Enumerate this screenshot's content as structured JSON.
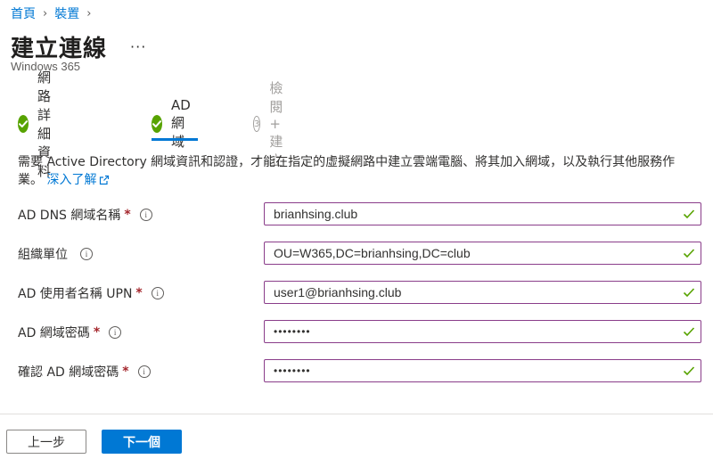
{
  "breadcrumb": {
    "home": "首頁",
    "devices": "裝置"
  },
  "header": {
    "title": "建立連線",
    "more": "···",
    "subtitle": "Windows 365"
  },
  "steps": [
    {
      "label": "網路詳細資料",
      "state": "done"
    },
    {
      "label": "AD 網域",
      "state": "current"
    },
    {
      "label": "檢閱 + 建立",
      "number": "3",
      "state": "disabled"
    }
  ],
  "description": {
    "text": "需要 Active Directory 網域資訊和認證，才能在指定的虛擬網路中建立雲端電腦、將其加入網域，以及執行其他服務作業。",
    "link": "深入了解"
  },
  "fields": [
    {
      "label": "AD DNS 網域名稱",
      "required": "*",
      "value": "brianhsing.club"
    },
    {
      "label": "組織單位",
      "required": "",
      "value": "OU=W365,DC=brianhsing,DC=club"
    },
    {
      "label": "AD 使用者名稱 UPN",
      "required": "*",
      "value": "user1@brianhsing.club"
    },
    {
      "label": "AD 網域密碼",
      "required": "*",
      "value": "••••••••"
    },
    {
      "label": "確認 AD 網域密碼",
      "required": "*",
      "value": "••••••••"
    }
  ],
  "info_glyph": "i",
  "buttons": {
    "previous": "上一步",
    "next": "下一個"
  },
  "colors": {
    "accent": "#0078d4",
    "success": "#57a300",
    "required": "#a4262c",
    "input_border": "#8a3d8a"
  }
}
